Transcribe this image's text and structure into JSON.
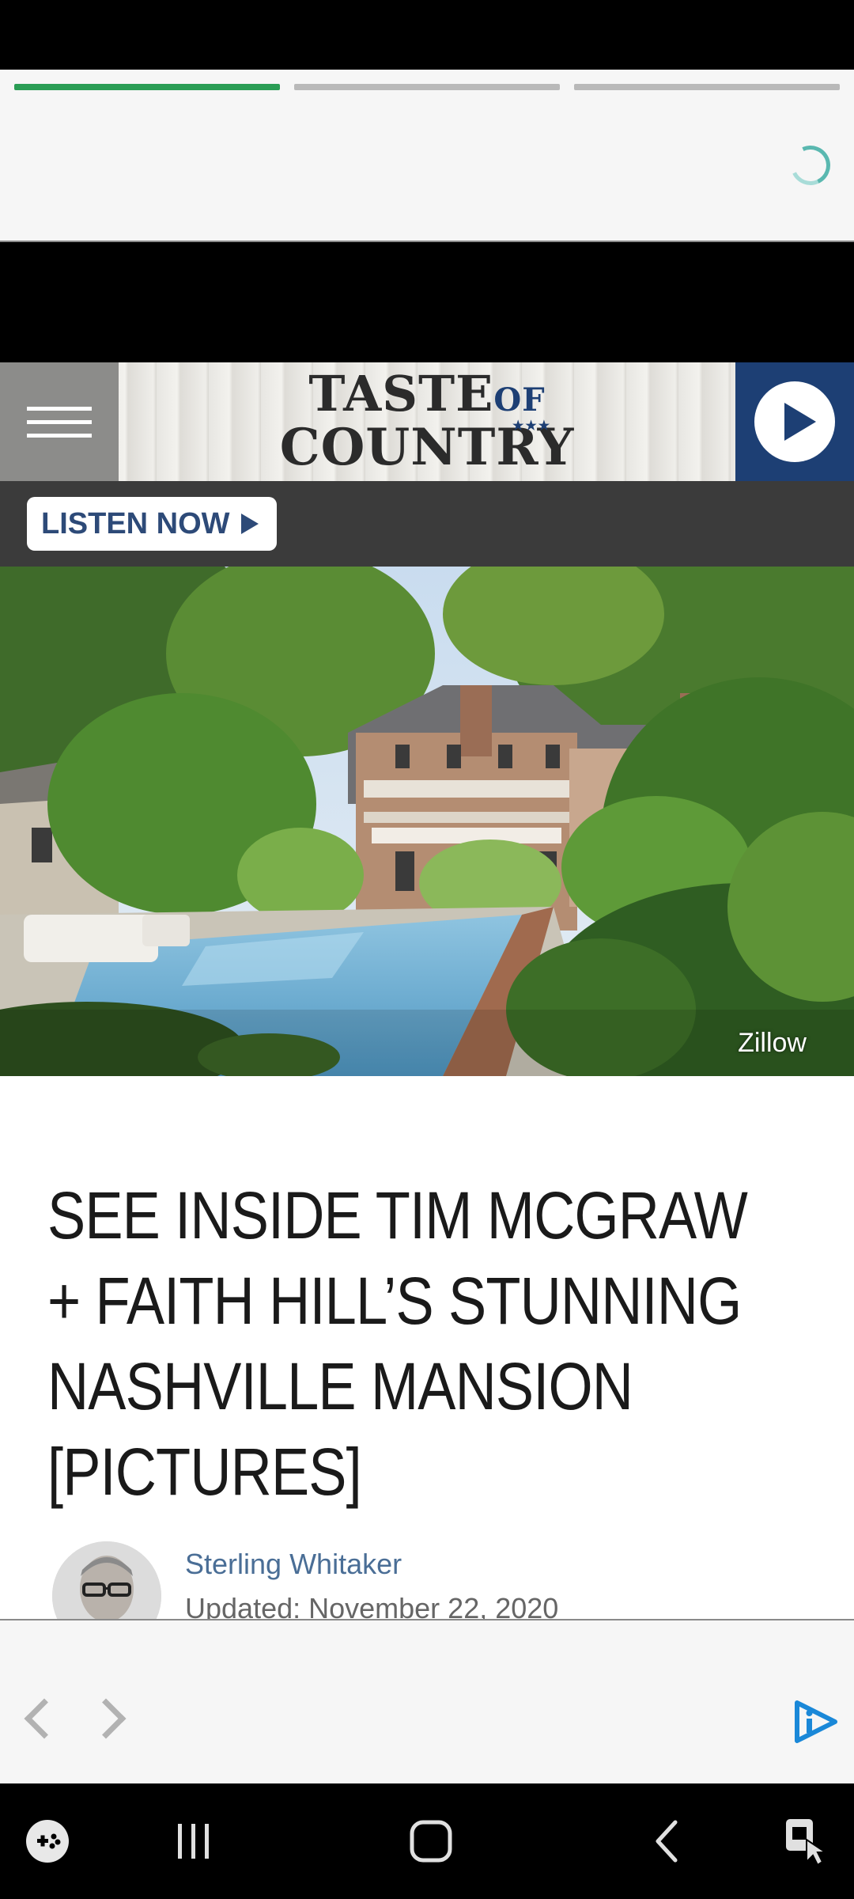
{
  "story": {
    "progress_segments": [
      {
        "state": "active"
      },
      {
        "state": "inactive"
      },
      {
        "state": "inactive"
      }
    ]
  },
  "header": {
    "logo_line1": "TASTE",
    "logo_of": "OF",
    "logo_stars": "★★★",
    "logo_line2": "COUNTRY",
    "listen_label": "LISTEN NOW",
    "brand_color": "#1d3f74"
  },
  "hero": {
    "credit": "Zillow"
  },
  "article": {
    "headline_lines": [
      "SEE INSIDE TIM MCGRAW",
      "+ FAITH HILL’S STUNNING",
      "NASHVILLE MANSION",
      "[PICTURES]"
    ],
    "author": "Sterling Whitaker",
    "updated": "Updated: November 22, 2020"
  },
  "nav": {
    "prev_icon": "chevron-left-icon",
    "next_icon": "chevron-right-icon",
    "ad_icon": "adchoices-icon",
    "accent": "#1a88d8"
  },
  "system_nav": [
    "game-launcher-icon",
    "recents-icon",
    "home-icon",
    "back-icon",
    "accessibility-icon"
  ]
}
